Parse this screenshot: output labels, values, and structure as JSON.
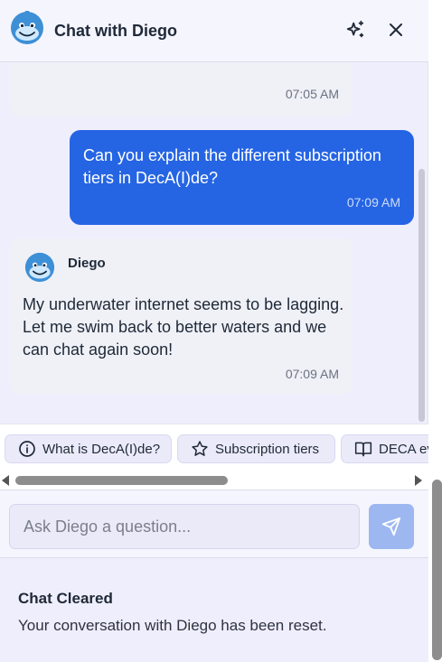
{
  "header": {
    "title": "Chat with Diego",
    "avatar_icon": "dolphin-avatar-icon",
    "sparkle_icon": "sparkle-icon",
    "close_icon": "close-icon"
  },
  "messages": [
    {
      "role": "bot",
      "text": "",
      "time": "07:05 AM"
    },
    {
      "role": "user",
      "text_lines": [
        "Can you explain the different subscription",
        "tiers in DecA(I)de?"
      ],
      "time": "07:09 AM"
    },
    {
      "role": "bot",
      "sender": "Diego",
      "text_lines": [
        "My underwater internet seems to be lagging.",
        "Let me swim back to better waters and we",
        "can chat again soon!"
      ],
      "time": "07:09 AM"
    }
  ],
  "suggestions": [
    {
      "label": "What is DecA(I)de?",
      "icon": "info-icon"
    },
    {
      "label": "Subscription tiers",
      "icon": "star-icon"
    },
    {
      "label": "DECA ev",
      "icon": "book-icon"
    }
  ],
  "input": {
    "placeholder": "Ask Diego a question...",
    "value": "",
    "send_icon": "send-icon"
  },
  "toast": {
    "title": "Chat Cleared",
    "description": "Your conversation with Diego has been reset."
  },
  "colors": {
    "user_bubble": "#2565e4",
    "bot_bubble": "#eff1f7",
    "panel_bg": "#efeefc",
    "send_button": "#9db7f1"
  }
}
